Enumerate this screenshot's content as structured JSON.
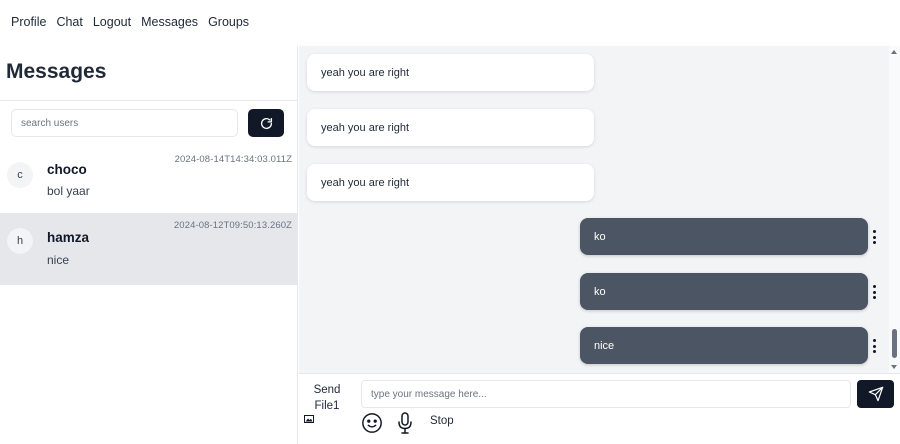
{
  "nav": {
    "items": [
      {
        "label": "Profile"
      },
      {
        "label": "Chat"
      },
      {
        "label": "Logout"
      },
      {
        "label": "Messages"
      },
      {
        "label": "Groups"
      }
    ]
  },
  "sidebar": {
    "title": "Messages",
    "search_placeholder": "search users",
    "refresh_icon": "refresh-icon",
    "conversations": [
      {
        "initial": "c",
        "name": "choco",
        "timestamp": "2024-08-14T14:34:03.011Z",
        "preview": "bol yaar",
        "active": false
      },
      {
        "initial": "h",
        "name": "hamza",
        "timestamp": "2024-08-12T09:50:13.260Z",
        "preview": "nice",
        "active": true
      }
    ]
  },
  "chat": {
    "messages": [
      {
        "direction": "incoming",
        "text": "yeah you are right"
      },
      {
        "direction": "incoming",
        "text": "yeah you are right"
      },
      {
        "direction": "incoming",
        "text": "yeah you are right"
      },
      {
        "direction": "outgoing",
        "text": "ko"
      },
      {
        "direction": "outgoing",
        "text": "ko"
      },
      {
        "direction": "outgoing",
        "text": "nice"
      }
    ]
  },
  "composer": {
    "send_file_label": "Send File1",
    "input_placeholder": "type your message here...",
    "input_value": "",
    "send_icon": "paper-plane-icon",
    "emoji_icon": "smiley-icon",
    "mic_icon": "microphone-icon",
    "stop_label": "Stop"
  },
  "colors": {
    "primary": "#111827",
    "outgoing_bubble": "#4b5563",
    "chat_background": "#f3f4f6",
    "active_conversation": "#e5e7eb"
  }
}
